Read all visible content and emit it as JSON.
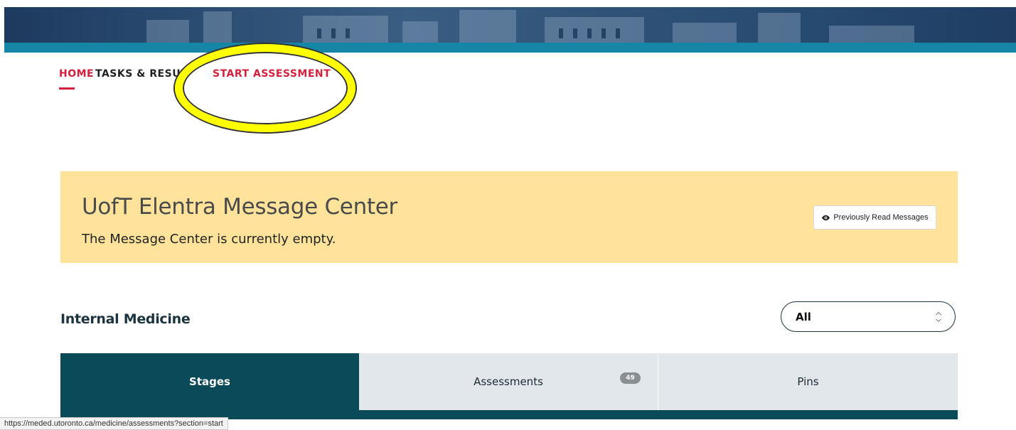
{
  "nav": {
    "home": "HOME",
    "tasks": "TASKS & RESULTS",
    "start": "START ASSESSMENT"
  },
  "message_center": {
    "title": "UofT Elentra Message Center",
    "empty_text": "The Message Center is currently empty.",
    "previous_button": "Previously Read Messages"
  },
  "section": {
    "title": "Internal Medicine",
    "filter_value": "All"
  },
  "tabs": {
    "stages": "Stages",
    "assessments": "Assessments",
    "assessments_count": "49",
    "pins": "Pins"
  },
  "status_bar": {
    "url": "https://meded.utoronto.ca/medicine/assessments?section=start"
  },
  "colors": {
    "accent_red": "#d5203d",
    "teal": "#0b4a58",
    "banner_strip": "#1586a5",
    "message_bg": "#ffe39a",
    "highlight": "#ffff00"
  },
  "icons": {
    "eye": "eye-icon",
    "select_arrows": "chevron-up-down-icon"
  }
}
